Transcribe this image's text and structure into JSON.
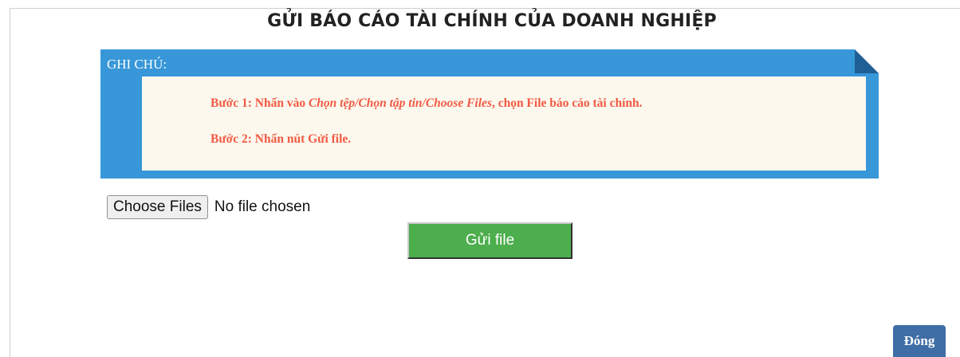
{
  "dialog": {
    "title": "GỬI BÁO CÁO TÀI CHÍNH CỦA DOANH NGHIỆP"
  },
  "note": {
    "label": "GHI CHÚ:",
    "step1_prefix": "Bước 1: Nhấn vào ",
    "step1_italic": "Chọn tệp/Chọn tập tin/Choose Files",
    "step1_suffix": ", chọn File báo cáo tài chính.",
    "step2": "Bước 2: Nhấn nút Gửi file."
  },
  "file_input": {
    "button_label": "Choose Files",
    "status": "No file chosen"
  },
  "actions": {
    "send_label": "Gửi file",
    "close_label": "Đóng"
  },
  "colors": {
    "note_blue": "#3797d9",
    "note_inner_bg": "#fdf8ee",
    "step_text": "#f05a43",
    "send_green": "#4cae4c",
    "close_blue": "#3f6ea6"
  }
}
